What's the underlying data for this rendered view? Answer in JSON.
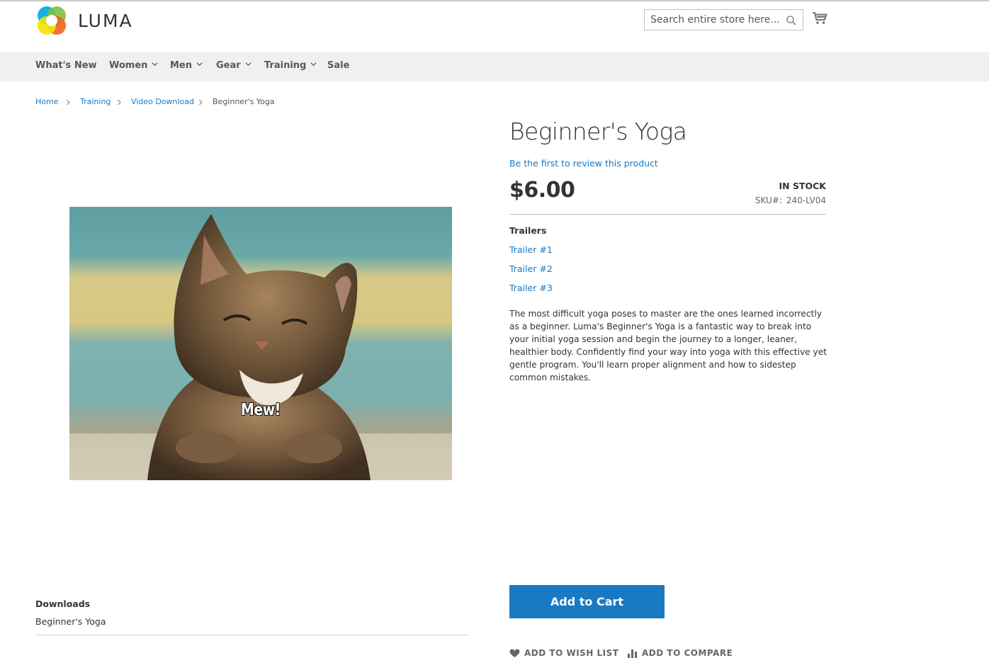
{
  "header": {
    "logo_text": "LUMA",
    "search_placeholder": "Search entire store here...",
    "cart_icon": "cart-icon",
    "search_icon": "search-icon"
  },
  "nav": {
    "items": [
      {
        "label": "What's New",
        "has_dropdown": false
      },
      {
        "label": "Women",
        "has_dropdown": true
      },
      {
        "label": "Men",
        "has_dropdown": true
      },
      {
        "label": "Gear",
        "has_dropdown": true
      },
      {
        "label": "Training",
        "has_dropdown": true
      },
      {
        "label": "Sale",
        "has_dropdown": false
      }
    ]
  },
  "breadcrumb": {
    "items": [
      "Home",
      "Training",
      "Video Download",
      "Beginner's Yoga"
    ]
  },
  "product": {
    "image_caption": "Mew!",
    "title": "Beginner's Yoga",
    "review_link": "Be the first to review this product",
    "price": "$6.00",
    "stock": "In stock",
    "sku_label": "SKU#:",
    "sku": "240-LV04",
    "trailers_title": "Trailers",
    "trailers": [
      "Trailer #1",
      "Trailer #2",
      "Trailer #3"
    ],
    "description": "The most difficult yoga poses to master are the ones learned incorrectly as a beginner. Luma's Beginner's Yoga is a fantastic way to break into your initial yoga session and begin the journey to a longer, leaner, healthier body. Confidently find your way into yoga with this effective yet gentle program. You'll learn proper alignment and how to sidestep common mistakes.",
    "add_to_cart": "Add to Cart",
    "wishlist": "Add to Wish List",
    "compare": "Add to Compare"
  },
  "downloads": {
    "title": "Downloads",
    "items": [
      "Beginner's Yoga"
    ]
  },
  "colors": {
    "link": "#1979c3",
    "button": "#1979c3",
    "nav_bg": "#f0f0f0"
  }
}
